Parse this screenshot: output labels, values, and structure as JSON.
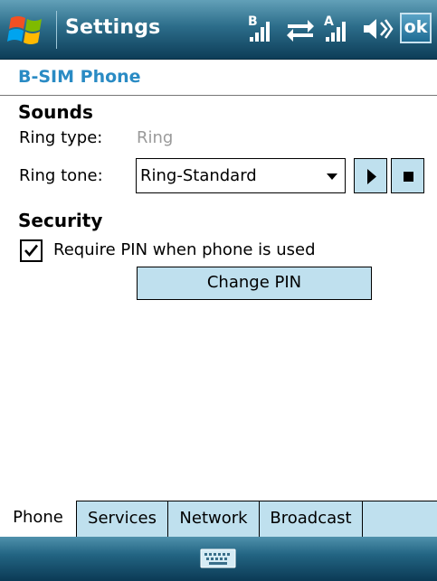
{
  "titlebar": {
    "title": "Settings",
    "ok_label": "ok",
    "status_icons": [
      "sim-b-signal-icon",
      "sync-arrows-icon",
      "sim-a-signal-icon",
      "speaker-icon"
    ]
  },
  "header": {
    "title": "B-SIM Phone"
  },
  "sounds": {
    "section_title": "Sounds",
    "ring_type_label": "Ring type:",
    "ring_type_value": "Ring",
    "ring_tone_label": "Ring tone:",
    "ring_tone_value": "Ring-Standard"
  },
  "security": {
    "section_title": "Security",
    "require_pin_label": "Require PIN when phone is used",
    "require_pin_checked": true,
    "change_pin_label": "Change PIN"
  },
  "tabs": [
    {
      "label": "Phone",
      "active": true
    },
    {
      "label": "Services",
      "active": false
    },
    {
      "label": "Network",
      "active": false
    },
    {
      "label": "Broadcast",
      "active": false
    }
  ],
  "colors": {
    "header_accent": "#2a8bc4",
    "button_fill": "#bfe0ee",
    "bar_dark": "#0d3d58"
  }
}
